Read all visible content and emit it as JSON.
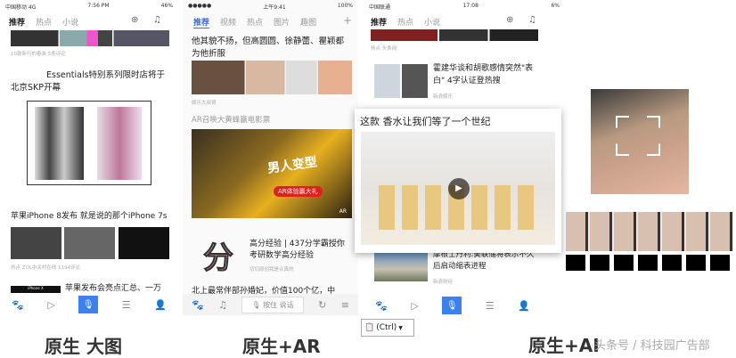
{
  "phone1": {
    "status": {
      "carrier": "中国移动 4G",
      "time": "7:56 PM",
      "battery": "46%"
    },
    "tabs": [
      "推荐",
      "热点",
      "小说"
    ],
    "meta1": "10款新行的春装  5条评论",
    "headline1": "Essentials特别系列限时店将于北京SKP开幕",
    "headline2": "苹果iPhone 8发布 就是说的那个iPhone 7s",
    "meta2": "热点  ZOL中关村在线  1194评论",
    "image_label": "iPhone X",
    "headline3": "苹果发布会亮点汇总、一万",
    "caption": "原生 大图"
  },
  "phone2": {
    "status": {
      "time": "上午9:41",
      "battery": "100%"
    },
    "tabs": [
      "推荐",
      "视频",
      "热点",
      "图片",
      "趣图"
    ],
    "plus": "+",
    "headline1": "他其貌不扬，但高圆圆、徐静蕾、瞿颖都为他折服",
    "meta1": "娱乐大叔哥",
    "headline2": "AR召唤大黄蜂赢电影票",
    "ar_text1": "男人变型",
    "ar_text2": "AR体验赢大礼",
    "ar_badge": "AR",
    "fen": "分",
    "headline3": "高分经验 | 437分学霸授你考研数学高分经验",
    "meta3": "切切原创我是认真的",
    "headline4": "北上最常伴部孙婚妃，价值100个亿，中",
    "voice": "按住 说话",
    "caption": "原生+AR"
  },
  "phone3": {
    "status": {
      "carrier": "中国联通",
      "time": "17:08",
      "battery": "6%"
    },
    "tabs": [
      "推荐",
      "热点",
      "小说"
    ],
    "meta1": "热点  头条网",
    "headline1": "霍建华谈和胡歌感情突然\"表白\" 4字认证登热搜",
    "meta2": "新浪娱乐",
    "popup_title": "这款  香水让我们等了一个世纪",
    "headline2": "摩根士丹利:美联储将表示不久后启动缩表进程",
    "meta3": "新浪财经",
    "ctrl": "(Ctrl)"
  },
  "right": {
    "caption": "原生+AI",
    "watermark": "头条号 / 科技园广告部"
  }
}
